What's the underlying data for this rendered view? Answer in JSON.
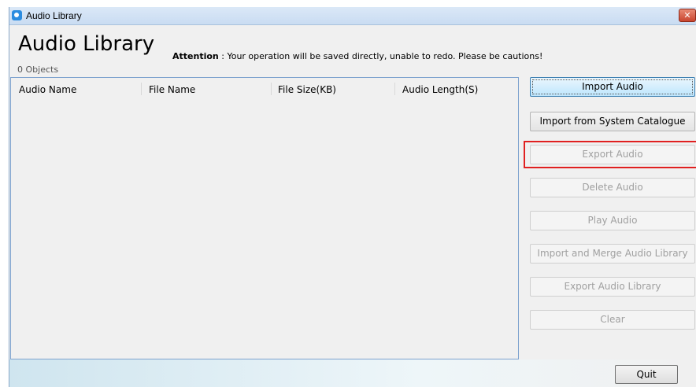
{
  "window": {
    "title": "Audio Library",
    "close_glyph": "✕"
  },
  "header": {
    "title": "Audio Library",
    "object_count": "0 Objects",
    "attention_label": "Attention",
    "attention_text": " : Your operation will be saved directly, unable to redo. Please be cautions!"
  },
  "table": {
    "columns": [
      "Audio Name",
      "File Name",
      "File Size(KB)",
      "Audio Length(S)"
    ],
    "rows": []
  },
  "actions": [
    {
      "label": "Import Audio",
      "enabled": true,
      "focused": true
    },
    {
      "label": "Import from System Catalogue",
      "enabled": true
    },
    {
      "label": "Export Audio",
      "enabled": false,
      "highlighted": true
    },
    {
      "label": "Delete Audio",
      "enabled": false
    },
    {
      "label": "Play Audio",
      "enabled": false
    },
    {
      "label": "Import and Merge Audio Library",
      "enabled": false
    },
    {
      "label": "Export Audio Library",
      "enabled": false
    },
    {
      "label": "Clear",
      "enabled": false
    }
  ],
  "footer": {
    "quit_label": "Quit"
  },
  "colors": {
    "highlight": "#e02020",
    "panel_border": "#7da2ce"
  }
}
